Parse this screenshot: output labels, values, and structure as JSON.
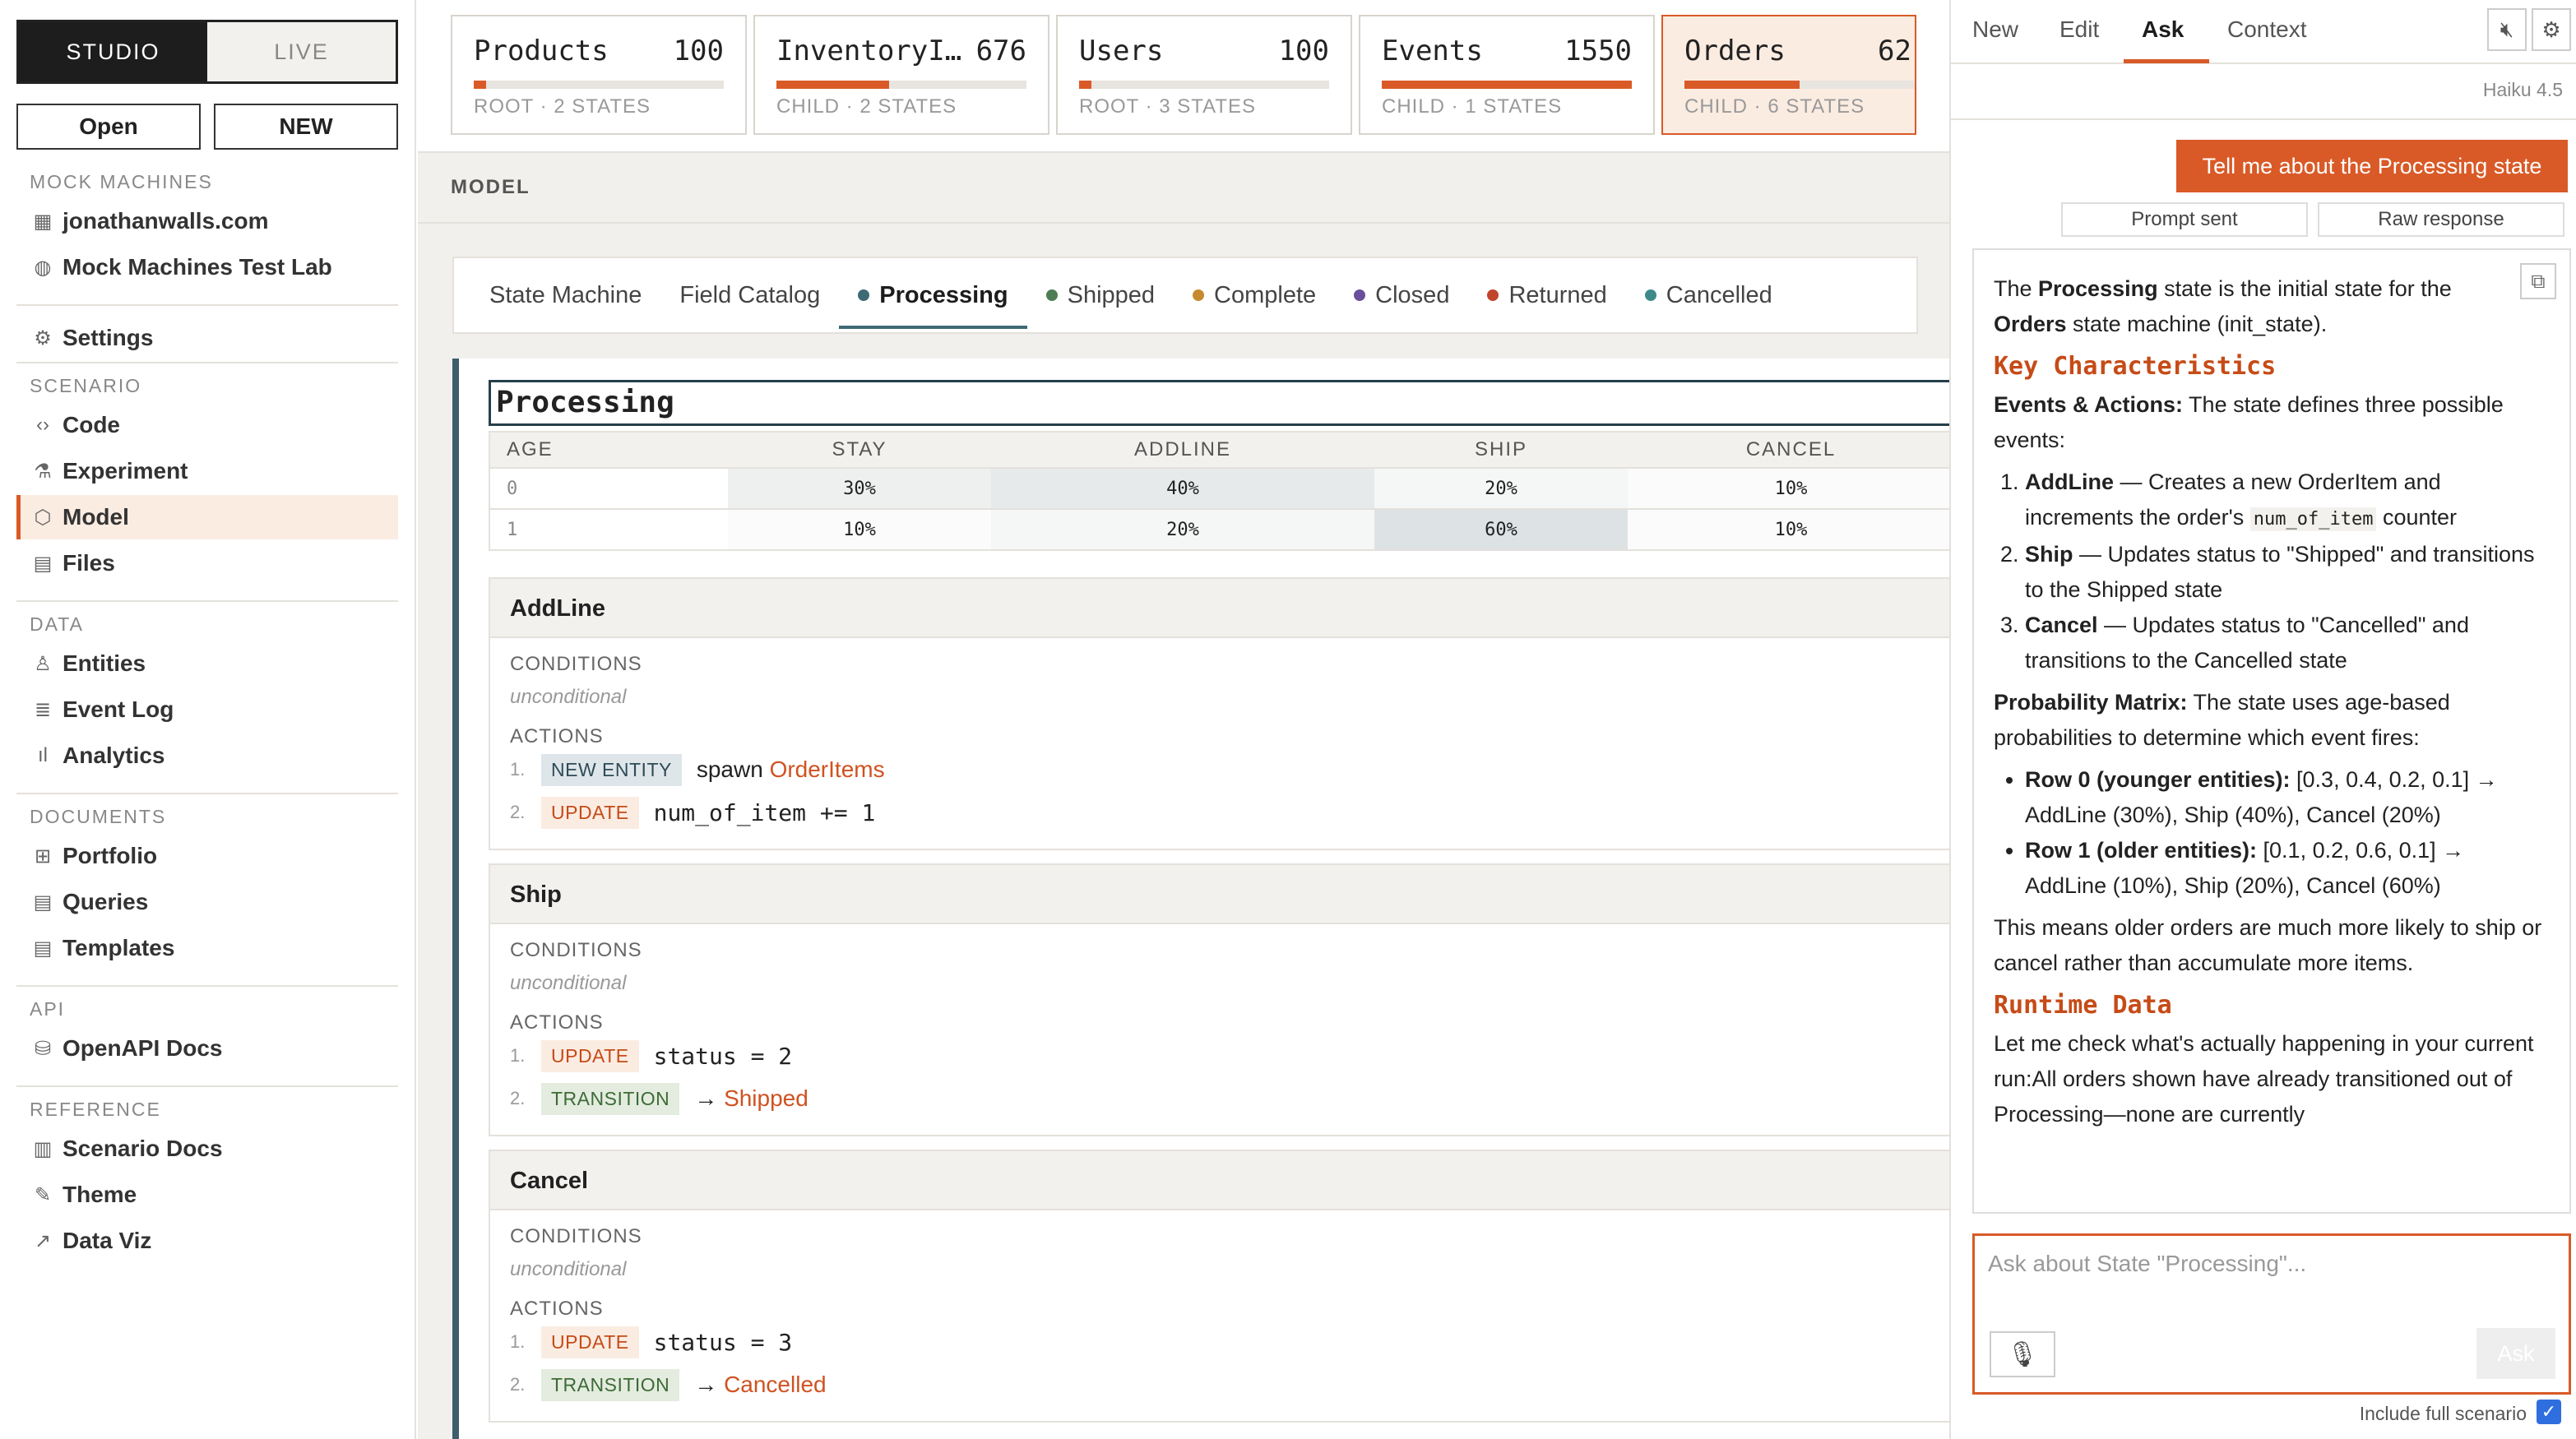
{
  "sidebar": {
    "mode_studio": "STUDIO",
    "mode_live": "LIVE",
    "open": "Open",
    "new": "NEW",
    "sec_machines": "MOCK MACHINES",
    "m1": "jonathanwalls.com",
    "m2": "Mock Machines Test Lab",
    "settings": "Settings",
    "sec_scenario": "SCENARIO",
    "code": "Code",
    "experiment": "Experiment",
    "model": "Model",
    "files": "Files",
    "sec_data": "DATA",
    "entities": "Entities",
    "eventlog": "Event Log",
    "analytics": "Analytics",
    "sec_docs": "DOCUMENTS",
    "portfolio": "Portfolio",
    "queries": "Queries",
    "templates": "Templates",
    "sec_api": "API",
    "openapi": "OpenAPI Docs",
    "sec_ref": "REFERENCE",
    "scendocs": "Scenario Docs",
    "theme": "Theme",
    "dataviz": "Data Viz"
  },
  "cards": [
    {
      "name": "Products",
      "value": "100",
      "sub": "ROOT · 2 STATES",
      "fill": 0.05
    },
    {
      "name": "InventoryI…",
      "value": "676",
      "sub": "CHILD · 2 STATES",
      "fill": 0.45
    },
    {
      "name": "Users",
      "value": "100",
      "sub": "ROOT · 3 STATES",
      "fill": 0.05
    },
    {
      "name": "Events",
      "value": "1550",
      "sub": "CHILD · 1 STATES",
      "fill": 1.0
    },
    {
      "name": "Orders",
      "value": "62",
      "sub": "CHILD · 6 STATES",
      "fill": 0.5
    }
  ],
  "model_header": "MODEL",
  "tabs": [
    "State Machine",
    "Field Catalog",
    "Processing",
    "Shipped",
    "Complete",
    "Closed",
    "Returned",
    "Cancelled"
  ],
  "tab_colors": {
    "processing": "#3e6a74",
    "shipped": "#4d7d52",
    "complete": "#c68a2e",
    "closed": "#6a4f9a",
    "returned": "#c0452a",
    "cancelled": "#3e8a8a"
  },
  "state": {
    "name": "Processing",
    "matrix": {
      "headers": [
        "AGE",
        "STAY",
        "ADDLINE",
        "SHIP",
        "CANCEL"
      ],
      "rows": [
        [
          "0",
          "30%",
          "40%",
          "20%",
          "10%"
        ],
        [
          "1",
          "10%",
          "20%",
          "60%",
          "10%"
        ]
      ]
    },
    "labels": {
      "conditions": "CONDITIONS",
      "actions": "ACTIONS",
      "unconditional": "unconditional"
    },
    "events": [
      {
        "name": "AddLine",
        "a1_tag": "NEW ENTITY",
        "a1_text": "spawn ",
        "a1_link": "OrderItems",
        "a2_tag": "UPDATE",
        "a2_text": "num_of_item += 1"
      },
      {
        "name": "Ship",
        "a1_tag": "UPDATE",
        "a1_text": "status = 2",
        "a2_tag": "TRANSITION",
        "a2_text": "→ ",
        "a2_link": "Shipped"
      },
      {
        "name": "Cancel",
        "a1_tag": "UPDATE",
        "a1_text": "status = 3",
        "a2_tag": "TRANSITION",
        "a2_text": "→ ",
        "a2_link": "Cancelled"
      }
    ]
  },
  "right": {
    "tabs": [
      "New",
      "Edit",
      "Ask",
      "Context"
    ],
    "model": "Haiku 4.5",
    "user_msg": "Tell me about the Processing state",
    "prompt_sent": "Prompt sent",
    "raw_response": "Raw response",
    "p1a": "The ",
    "p1b": "Processing",
    "p1c": " state is the initial state for the ",
    "p1d": "Orders",
    "p1e": " state machine (init_state).",
    "h1": "Key Characteristics",
    "p2a": "Events & Actions:",
    "p2b": " The state defines three possible events:",
    "li1a": "AddLine",
    "li1b": " — Creates a new OrderItem and increments the order's ",
    "li1c": "num_of_item",
    "li1d": " counter",
    "li2a": "Ship",
    "li2b": " — Updates status to \"Shipped\" and transitions to the Shipped state",
    "li3a": "Cancel",
    "li3b": " — Updates status to \"Cancelled\" and transitions to the Cancelled state",
    "p3a": "Probability Matrix:",
    "p3b": " The state uses age-based probabilities to determine which event fires:",
    "b1a": "Row 0 (younger entities):",
    "b1b": " [0.3, 0.4, 0.2, 0.1] → AddLine (30%), Ship (40%), Cancel (20%)",
    "b2a": "Row 1 (older entities):",
    "b2b": " [0.1, 0.2, 0.6, 0.1] → AddLine (10%), Ship (20%), Cancel (60%)",
    "p4": "This means older orders are much more likely to ship or cancel rather than accumulate more items.",
    "h2": "Runtime Data",
    "p5": "Let me check what's actually happening in your current run:All orders shown have already transitioned out of Processing—none are currently",
    "placeholder": "Ask about State \"Processing\"...",
    "ask": "Ask",
    "include": "Include full scenario"
  }
}
